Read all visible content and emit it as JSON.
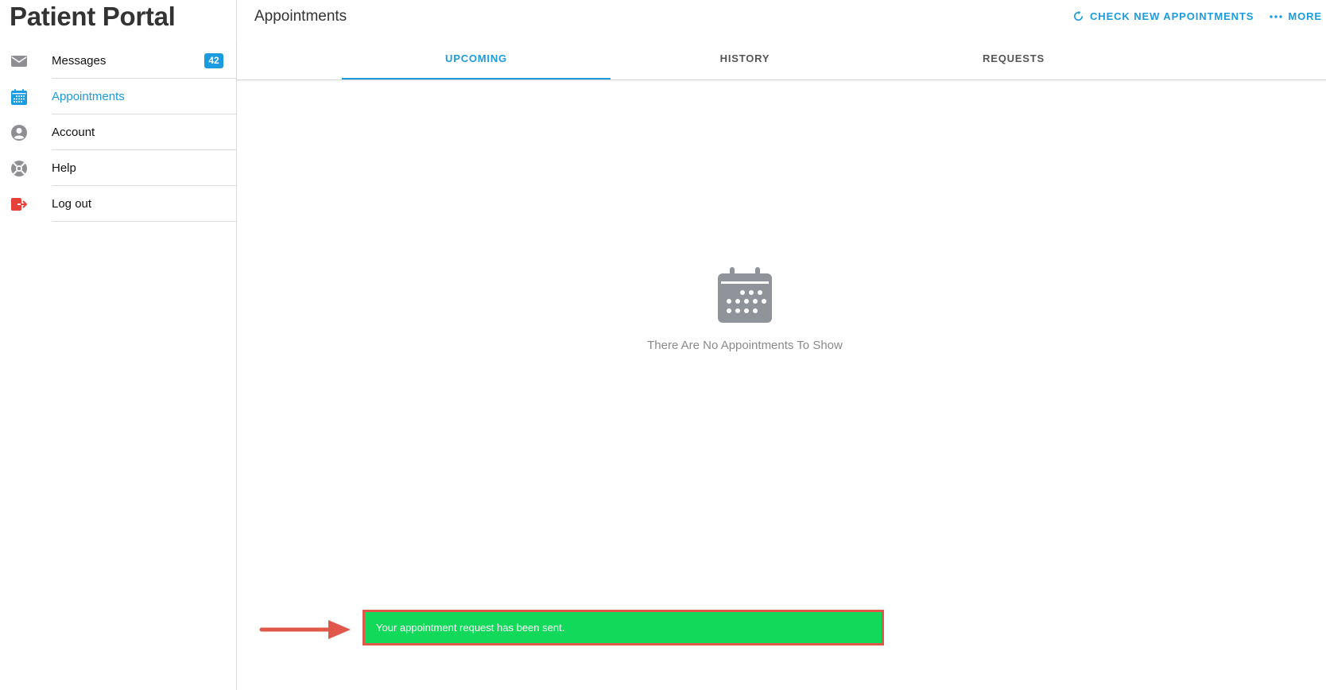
{
  "app": {
    "title": "Patient Portal"
  },
  "sidebar": {
    "items": [
      {
        "label": "Messages",
        "icon": "envelope-icon",
        "badge": "42"
      },
      {
        "label": "Appointments",
        "icon": "calendar-icon"
      },
      {
        "label": "Account",
        "icon": "user-circle-icon"
      },
      {
        "label": "Help",
        "icon": "lifebuoy-icon"
      },
      {
        "label": "Log out",
        "icon": "logout-icon"
      }
    ]
  },
  "header": {
    "title": "Appointments",
    "check_label": "CHECK NEW APPOINTMENTS",
    "more_label": "MORE"
  },
  "tabs": [
    {
      "label": "UPCOMING"
    },
    {
      "label": "HISTORY"
    },
    {
      "label": "REQUESTS"
    }
  ],
  "empty_state": {
    "message": "There Are No Appointments To Show",
    "icon": "calendar-icon"
  },
  "toast": {
    "message": "Your appointment request has been sent."
  },
  "colors": {
    "accent": "#1b9be0",
    "toast_bg": "#13d95b",
    "toast_border": "#e0584a",
    "logout": "#e8403a",
    "icon_gray": "#8e8e93"
  }
}
